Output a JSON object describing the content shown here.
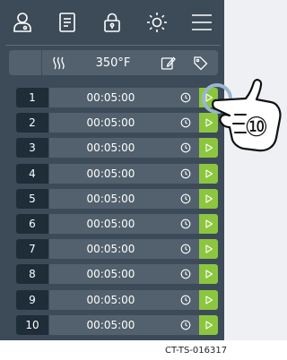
{
  "toolbar": {
    "icons": [
      "user-icon",
      "recipe-icon",
      "lock-icon",
      "brightness-icon",
      "menu-icon"
    ]
  },
  "status": {
    "heat_icon": "heat-icon",
    "temperature": "350°F",
    "edit_icon": "edit-icon",
    "tag_icon": "tag-icon"
  },
  "timers": [
    {
      "number": "1",
      "time": "00:05:00"
    },
    {
      "number": "2",
      "time": "00:05:00"
    },
    {
      "number": "3",
      "time": "00:05:00"
    },
    {
      "number": "4",
      "time": "00:05:00"
    },
    {
      "number": "5",
      "time": "00:05:00"
    },
    {
      "number": "6",
      "time": "00:05:00"
    },
    {
      "number": "7",
      "time": "00:05:00"
    },
    {
      "number": "8",
      "time": "00:05:00"
    },
    {
      "number": "9",
      "time": "00:05:00"
    },
    {
      "number": "10",
      "time": "00:05:00"
    }
  ],
  "callout": {
    "label": "⑩"
  },
  "footer": {
    "code": "CT-TS-016317"
  },
  "colors": {
    "panel": "#3c4b57",
    "row": "#52616d",
    "number_cell": "#1f2d39",
    "play_button": "#8cc63f",
    "callout_ring": "#9ab6cf"
  }
}
